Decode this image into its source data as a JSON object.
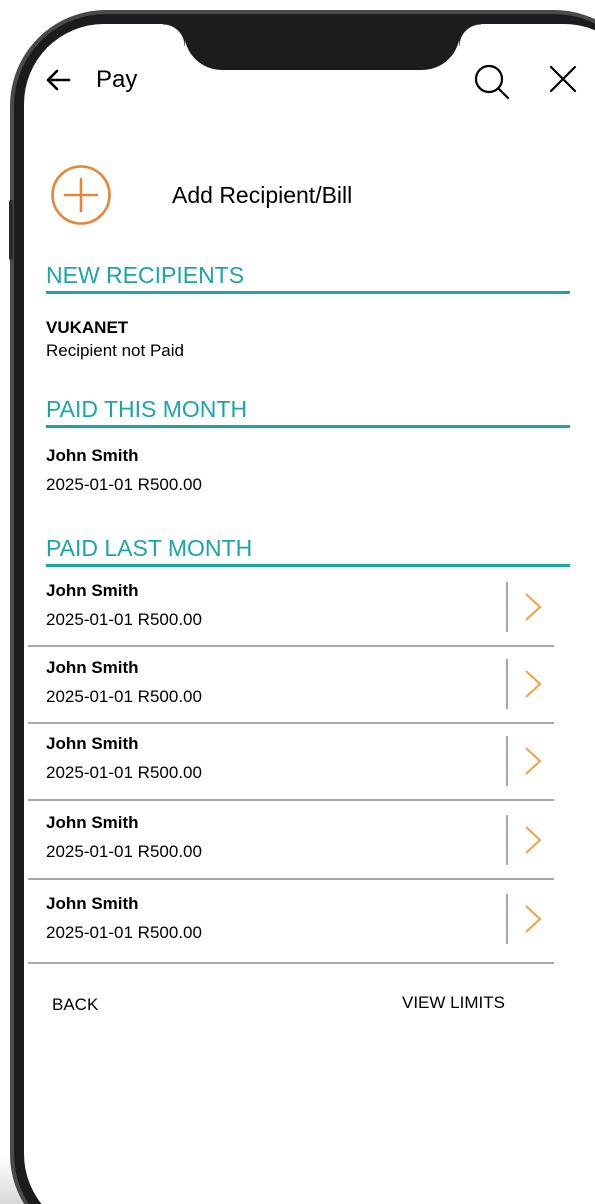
{
  "header": {
    "title": "Pay",
    "back_icon": "arrow-left-icon",
    "search_icon": "search-icon",
    "close_icon": "close-icon"
  },
  "add_recipient": {
    "label": "Add Recipient/Bill",
    "icon": "plus-circle-icon",
    "icon_color": "#e8833a"
  },
  "sections": {
    "new_recipients": {
      "title": "NEW RECIPIENTS",
      "items": [
        {
          "name": "VUKANET",
          "status": "Recipient not Paid"
        }
      ]
    },
    "paid_this_month": {
      "title": "PAID THIS MONTH",
      "items": [
        {
          "name": "John Smith",
          "date": "2025-01-01",
          "amount": "R500.00",
          "detail": "2025-01-01 R500.00"
        }
      ]
    },
    "paid_last_month": {
      "title": "PAID LAST MONTH",
      "items": [
        {
          "name": "John Smith",
          "detail": "2025-01-01 R500.00"
        },
        {
          "name": "John Smith",
          "detail": "2025-01-01 R500.00"
        },
        {
          "name": "John Smith",
          "detail": "2025-01-01 R500.00"
        },
        {
          "name": "John Smith",
          "detail": "2025-01-01 R500.00"
        },
        {
          "name": "John Smith",
          "detail": "2025-01-01 R500.00"
        }
      ]
    }
  },
  "footer": {
    "back_label": "BACK",
    "view_limits_label": "VIEW LIMITS"
  },
  "colors": {
    "accent_teal": "#1ca4ab",
    "accent_orange": "#e8833a",
    "divider_gray": "#a8a8a8"
  }
}
